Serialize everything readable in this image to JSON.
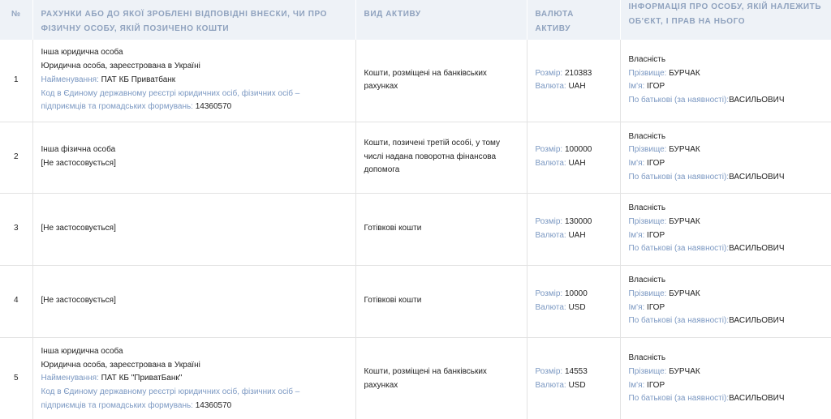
{
  "header": {
    "num": "№",
    "col_recipient": "РАХУНКИ АБО ДО ЯКОЇ ЗРОБЛЕНІ ВІДПОВІДНІ ВНЕСКИ, ЧИ ПРО ФІЗИЧНУ ОСОБУ, ЯКІЙ ПОЗИЧЕНО КОШТИ",
    "col_type": "ВИД АКТИВУ",
    "col_currency": "ВАЛЮТА АКТИВУ",
    "col_owner": "ІНФОРМАЦІЯ ПРО ОСОБУ, ЯКІЙ НАЛЕЖИТЬ ОБ'ЄКТ, І ПРАВ НА НЬОГО"
  },
  "labels": {
    "name": "Найменування: ",
    "code_line1": "Код в Єдиному державному реєстрі юридичних осіб, фізичних осіб –",
    "code_line2": "підприємців та громадських формувань: ",
    "size": "Розмір: ",
    "currency": "Валюта: ",
    "surname": "Прізвище: ",
    "firstname": "Ім'я: ",
    "patronymic": "По батькові (за наявності):"
  },
  "owner": {
    "right": "Власність",
    "surname": "БУРЧАК",
    "firstname": "ІГОР",
    "patronymic": "ВАСИЛЬОВИЧ"
  },
  "rows": [
    {
      "num": "1",
      "type_line1": "Інша юридична особа",
      "type_line2": "Юридична особа, зареєстрована в Україні",
      "name": "ПАТ КБ Приватбанк",
      "code": "14360570",
      "asset_line1": "Кошти, розміщені на банківських",
      "asset_line2": "рахунках",
      "size": "210383",
      "currency": "UAH"
    },
    {
      "num": "2",
      "type_line1": "Інша фізична особа",
      "type_line2": "[Не застосовується]",
      "asset_line1": "Кошти, позичені третій особі, у тому",
      "asset_line2": "числі надана поворотна фінансова",
      "asset_line3": "допомога",
      "size": "100000",
      "currency": "UAH"
    },
    {
      "num": "3",
      "type_line1": "[Не застосовується]",
      "asset_line1": "Готівкові кошти",
      "size": "130000",
      "currency": "UAH"
    },
    {
      "num": "4",
      "type_line1": "[Не застосовується]",
      "asset_line1": "Готівкові кошти",
      "size": "10000",
      "currency": "USD"
    },
    {
      "num": "5",
      "type_line1": "Інша юридична особа",
      "type_line2": "Юридична особа, зареєстрована в Україні",
      "name": "ПАТ КБ \"ПриватБанк\"",
      "code": "14360570",
      "asset_line1": "Кошти, розміщені на банківських",
      "asset_line2": "рахунках",
      "size": "14553",
      "currency": "USD"
    }
  ]
}
